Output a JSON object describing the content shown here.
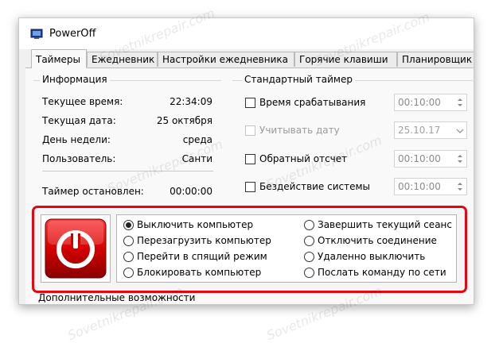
{
  "window": {
    "title": "PowerOff",
    "app_icon": "monitor-icon"
  },
  "tabs": [
    {
      "label": "Таймеры",
      "active": true
    },
    {
      "label": "Ежедневник",
      "active": false
    },
    {
      "label": "Настройки ежедневника",
      "active": false
    },
    {
      "label": "Горячие клавиши",
      "active": false
    },
    {
      "label": "Планировщик",
      "active": false
    }
  ],
  "info": {
    "title": "Информация",
    "rows": [
      {
        "label": "Текущее время:",
        "value": "22:34:09"
      },
      {
        "label": "Текущая дата:",
        "value": "25 октября"
      },
      {
        "label": "День недели:",
        "value": "среда"
      },
      {
        "label": "Пользователь:",
        "value": "Санти"
      }
    ],
    "status_label": "Таймер остановлен:",
    "status_value": "00:00:00"
  },
  "timer": {
    "title": "Стандартный таймер",
    "options": [
      {
        "label": "Время срабатывания",
        "checked": false,
        "enabled": true,
        "value": "00:10:00"
      },
      {
        "label": "Учитывать дату",
        "checked": false,
        "enabled": false,
        "value": "25.10.17"
      },
      {
        "label": "Обратный отсчет",
        "checked": false,
        "enabled": true,
        "value": "00:10:00"
      },
      {
        "label": "Бездействие системы",
        "checked": false,
        "enabled": true,
        "value": "00:10:00"
      }
    ]
  },
  "actions": {
    "icon": "power-icon",
    "left": [
      {
        "label": "Выключить компьютер",
        "checked": true
      },
      {
        "label": "Перезагрузить компьютер",
        "checked": false
      },
      {
        "label": "Перейти в спящий режим",
        "checked": false
      },
      {
        "label": "Блокировать компьютер",
        "checked": false
      }
    ],
    "right": [
      {
        "label": "Завершить текущий сеанс",
        "checked": false
      },
      {
        "label": "Отключить соединение",
        "checked": false
      },
      {
        "label": "Удаленно выключить",
        "checked": false
      },
      {
        "label": "Послать команду по сети",
        "checked": false
      }
    ],
    "highlight_color": "#e30613"
  },
  "extra": {
    "label": "Дополнительные возможности"
  },
  "watermark": "Sovetnikrepair.com"
}
